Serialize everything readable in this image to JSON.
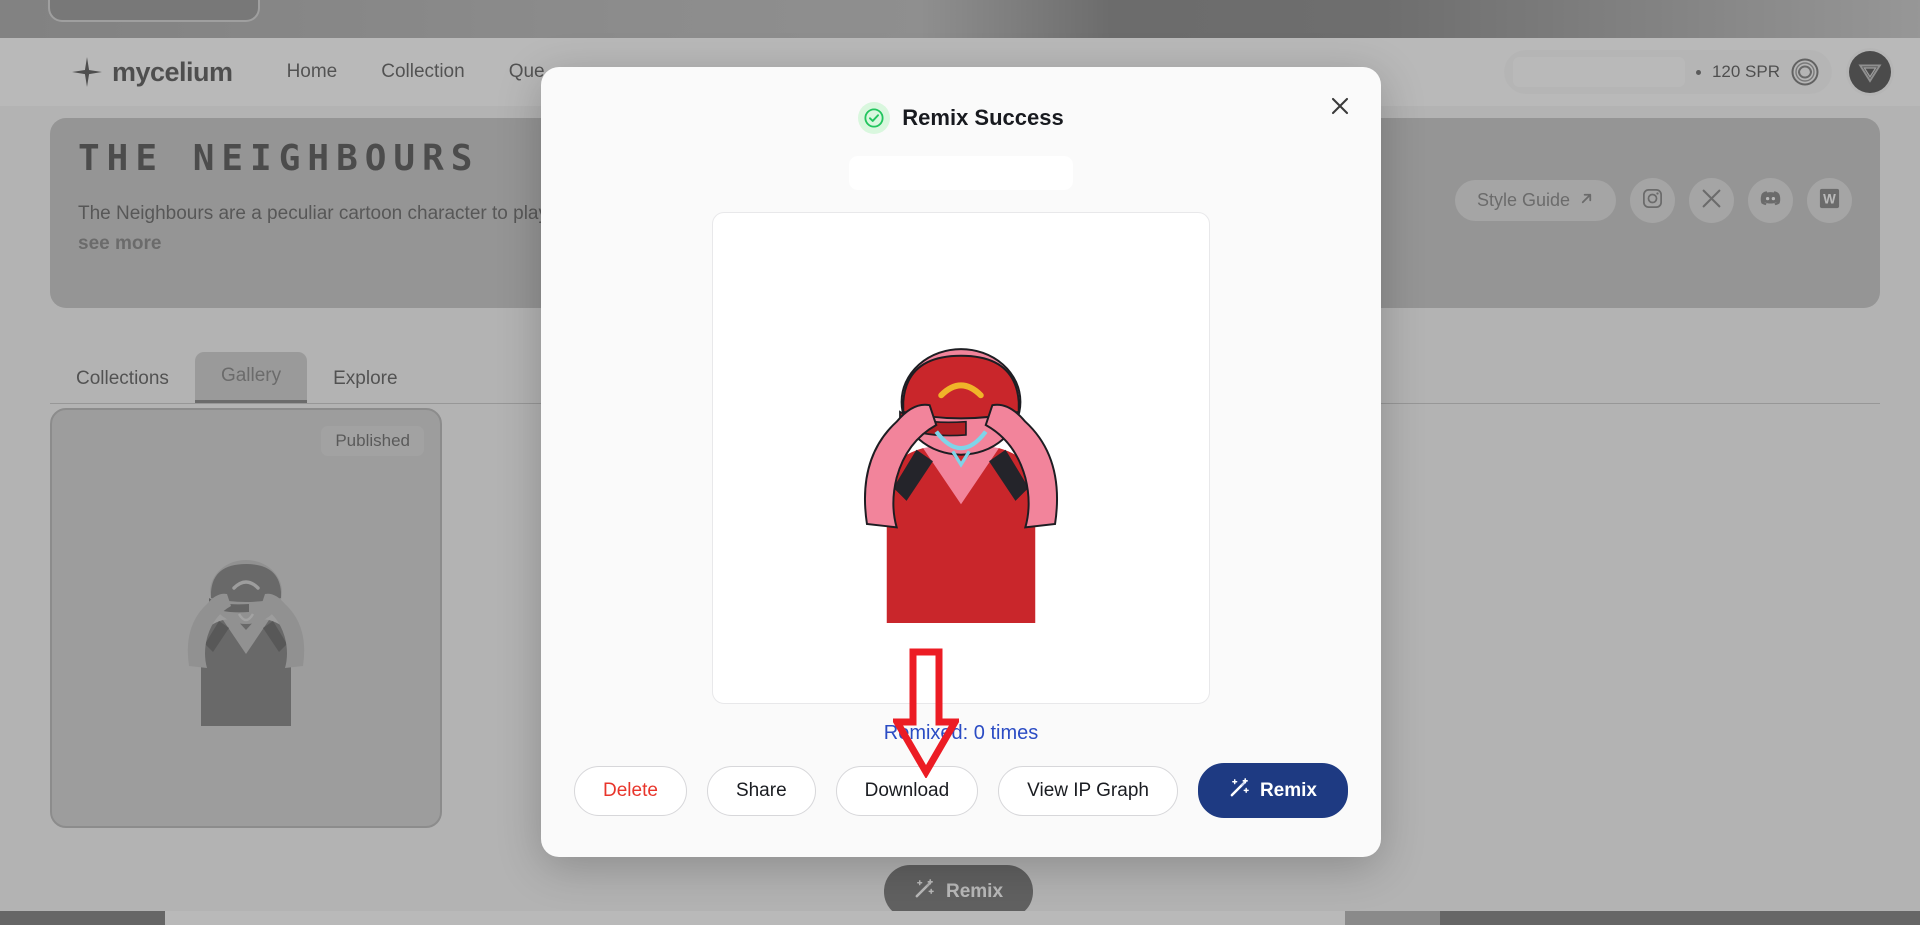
{
  "header": {
    "brand_name": "mycelium",
    "brand_icon": "eight-point-star-icon",
    "nav": [
      {
        "label": "Home"
      },
      {
        "label": "Collection"
      },
      {
        "label": "Que"
      }
    ],
    "wallet": {
      "address_redacted": "",
      "separator": "•",
      "balance": "120 SPR",
      "coin_icon": "spr-coin-icon",
      "refresh_icon": "spr-coin-icon"
    },
    "avatar": {
      "icon": "user-avatar-icon",
      "label": ""
    }
  },
  "hero": {
    "title": "THE NEIGHBOURS",
    "description": "The Neighbours are a peculiar cartoon character to play, empowering superfans to unleash their creativity throug",
    "see_more": "see more",
    "style_guide": {
      "label": "Style Guide",
      "icon": "external-link-arrow-icon"
    },
    "socials": [
      {
        "name": "instagram-icon"
      },
      {
        "name": "x-twitter-icon"
      },
      {
        "name": "discord-icon"
      },
      {
        "name": "w-brand-icon"
      }
    ]
  },
  "tabs": [
    {
      "label": "Collections",
      "active": false
    },
    {
      "label": "Gallery",
      "active": true
    },
    {
      "label": "Explore",
      "active": false
    }
  ],
  "gallery": {
    "card": {
      "status_badge": "Published",
      "artwork_alt": "pink-cartoon-character-red-cap-artwork"
    }
  },
  "floating_action": {
    "label": "Remix",
    "icon": "magic-wand-icon"
  },
  "modal": {
    "title": "Remix Success",
    "success_icon": "check-circle-icon",
    "close_icon": "close-icon",
    "name_redacted": "",
    "artwork_alt": "pink-cartoon-character-red-cap-artwork",
    "remix_count_text": "Remixed: 0 times",
    "buttons": [
      {
        "label": "Delete",
        "style": "danger"
      },
      {
        "label": "Share",
        "style": "default"
      },
      {
        "label": "Download",
        "style": "default"
      },
      {
        "label": "View IP Graph",
        "style": "default"
      },
      {
        "label": "Remix",
        "style": "primary",
        "icon": "magic-wand-icon"
      }
    ]
  },
  "annotation": {
    "arrow": "red-down-arrow-pointing-to-download-button"
  },
  "colors": {
    "primary_blue": "#1e3a82",
    "link_blue": "#2b4cc4",
    "danger_red": "#e8352b",
    "success_green": "#22c55e",
    "published_badge": "#a9c9ad",
    "annotation_red": "#ec1c24"
  }
}
